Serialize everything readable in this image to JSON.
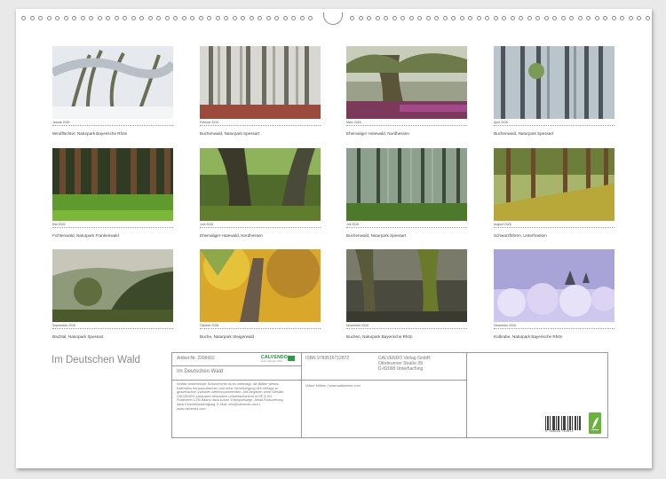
{
  "calendar_title": "Im Deutschen Wald",
  "months": [
    {
      "label": "Januar 2026",
      "caption": "Windflüchter, Naturpark Bayerische Rhön",
      "scene": "snow"
    },
    {
      "label": "Februar 2026",
      "caption": "Buchenwald, Naturpark Spessart",
      "scene": "misty-pink"
    },
    {
      "label": "März 2026",
      "caption": "Ehemaliger Hutewald, Nordhessen",
      "scene": "hutewald"
    },
    {
      "label": "April 2026",
      "caption": "Buchenwald, Naturpark Spessart",
      "scene": "blue-fog"
    },
    {
      "label": "Mai 2026",
      "caption": "Fichtenwald, Naturpark Frankenwald",
      "scene": "spruce"
    },
    {
      "label": "Juni 2026",
      "caption": "Ehemaliger Hutewald, Nordhessen",
      "scene": "green-oak"
    },
    {
      "label": "Juli 2026",
      "caption": "Buchenwald, Naturpark Spessart",
      "scene": "green-fog"
    },
    {
      "label": "August 2026",
      "caption": "Schwarzföhren, Unterfranken",
      "scene": "pine-sun"
    },
    {
      "label": "September 2026",
      "caption": "Bachtal, Naturpark Spessart",
      "scene": "valley"
    },
    {
      "label": "Oktober 2026",
      "caption": "Buche, Naturpark Steigerwald",
      "scene": "autumn"
    },
    {
      "label": "November 2026",
      "caption": "Buchen, Naturpark Bayerische Rhön",
      "scene": "dark-moss"
    },
    {
      "label": "Dezember 2026",
      "caption": "Kolbrabe, Naturpark Bayerische Rhön",
      "scene": "frost"
    }
  ],
  "info": {
    "article": "Artikel-Nr. 2206602",
    "product_title": "Im Deutschen Wald",
    "description": "Inhalte bestehender Schutzrechte ist es untersagt, die Blätter dieses Kalenders herauszutrennen und ohne Genehmigung des Verlags zu gewerblichen Zwecken weiterzuverwenden. Alle Angaben ohne Gewähr. CALVENDO produziert besonders umweltschonend in DE & EU. Positiverer CO2-Bilanz dank kurzer Transportwege. Abfall-Reduzierung dank Einzelstückfertigung. E-Mail: info@calvendo.com • www.calvendo.com",
    "logo": "CALVENDO",
    "logo_sub": "Kunst, Kalender, Kultur",
    "isbn": "ISBN 9783516712872",
    "author": "Volker Müther | www.waldwerke.com",
    "publisher_name": "CALVENDO Verlag GmbH",
    "publisher_street": "Ottobrunner Straße 39",
    "publisher_city": "D-82008 Unterhaching",
    "barcode_number": "9 783516 712872"
  },
  "colors": {
    "page_bg": "#e9e9e9",
    "border": "#9a9a9a",
    "logo_green": "#1a8a3a",
    "badge_green": "#6ab43e"
  }
}
